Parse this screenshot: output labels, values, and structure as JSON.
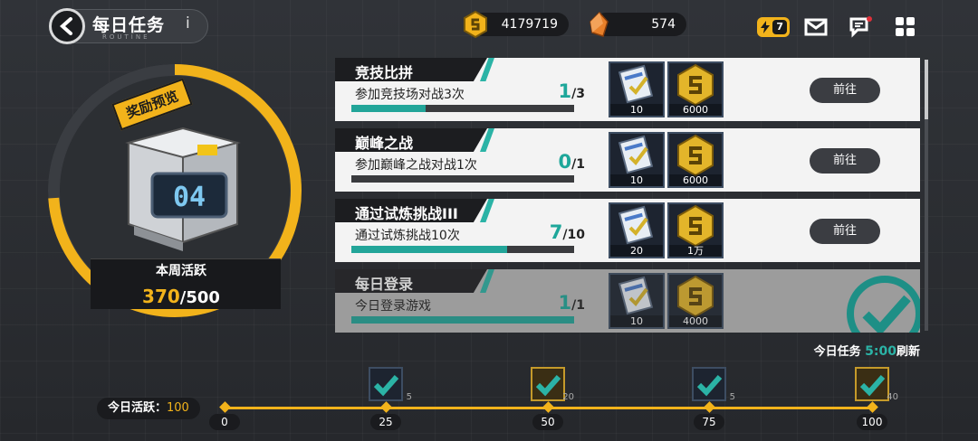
{
  "header": {
    "title": "每日任务",
    "subtitle": "ROUTINE",
    "info": "i",
    "coins": "4179719",
    "crystals": "574",
    "energy": "7"
  },
  "reward_box": {
    "tag": "奖励预览",
    "weekly_label": "本周活跃",
    "weekly_current": "370",
    "weekly_total": "/500",
    "weekly_progress": 0.74
  },
  "tasks": [
    {
      "title": "竞技比拼",
      "desc": "参加竞技场对战3次",
      "current": "1",
      "total": "/3",
      "progress": 0.333,
      "rewards": [
        {
          "icon": "ticket-icon",
          "count": "10"
        },
        {
          "icon": "coin-icon",
          "count": "6000"
        }
      ],
      "button": "前往",
      "done": false
    },
    {
      "title": "巅峰之战",
      "desc": "参加巅峰之战对战1次",
      "current": "0",
      "total": "/1",
      "progress": 0,
      "rewards": [
        {
          "icon": "ticket-icon",
          "count": "10"
        },
        {
          "icon": "coin-icon",
          "count": "6000"
        }
      ],
      "button": "前往",
      "done": false
    },
    {
      "title": "通过试炼挑战III",
      "desc": "通过试炼挑战10次",
      "current": "7",
      "total": "/10",
      "progress": 0.7,
      "rewards": [
        {
          "icon": "ticket-icon",
          "count": "20"
        },
        {
          "icon": "coin-icon",
          "count": "1万"
        }
      ],
      "button": "前往",
      "done": false
    },
    {
      "title": "每日登录",
      "desc": "今日登录游戏",
      "current": "1",
      "total": "/1",
      "progress": 1,
      "rewards": [
        {
          "icon": "ticket-icon",
          "count": "10"
        },
        {
          "icon": "coin-icon",
          "count": "4000"
        }
      ],
      "button": "",
      "done": true
    }
  ],
  "refresh": {
    "label": "今日任务",
    "time": "5:00",
    "suffix": "刷新"
  },
  "timeline": {
    "label": "今日活跃：",
    "value": "100",
    "ticks": [
      "0",
      "25",
      "50",
      "75",
      "100"
    ],
    "chests": [
      {
        "count": "5",
        "type": "teal"
      },
      {
        "count": "20",
        "type": "gold"
      },
      {
        "count": "5",
        "type": "teal"
      },
      {
        "count": "40",
        "type": "gold"
      }
    ]
  },
  "colors": {
    "accent": "#2bb3a6",
    "gold": "#f2b31b",
    "panel": "#1a1b1e"
  }
}
